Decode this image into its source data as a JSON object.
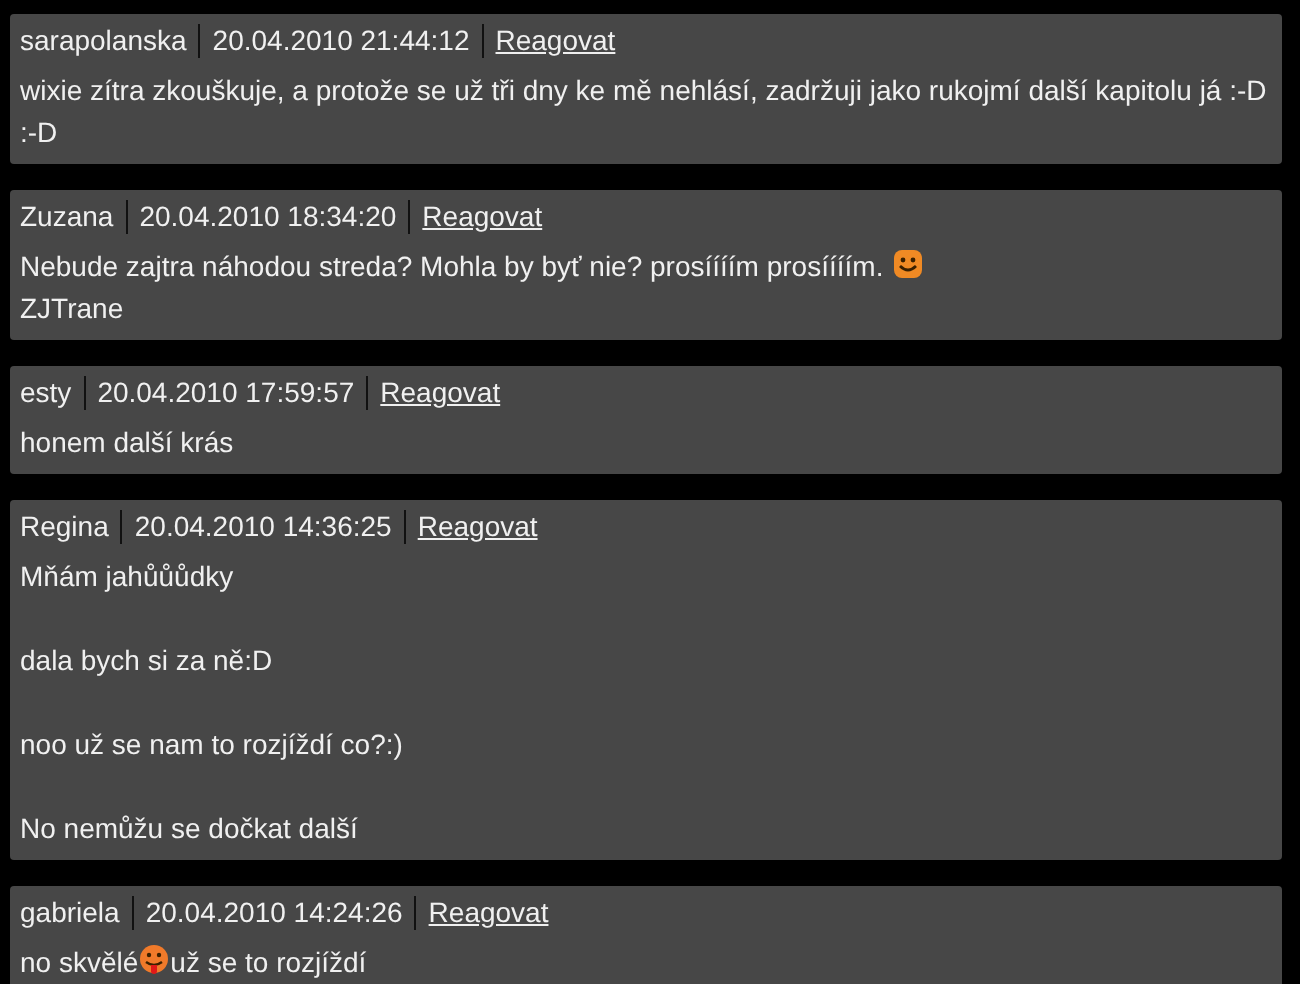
{
  "comments": [
    {
      "author": "sarapolanska",
      "date": "20.04.2010 21:44:12",
      "reply": "Reagovat",
      "paragraphs": [
        {
          "lines": [
            [
              {
                "kind": "text",
                "text": "wixie zítra zkouškuje, a protože se už tři dny ke mě nehlásí, zadržuji jako rukojmí další kapitolu já :-D :-D"
              }
            ]
          ]
        }
      ]
    },
    {
      "author": "Zuzana",
      "date": "20.04.2010 18:34:20",
      "reply": "Reagovat",
      "paragraphs": [
        {
          "lines": [
            [
              {
                "kind": "text",
                "text": "Nebude zajtra náhodou streda? Mohla by byť nie? prosíííím prosíííím."
              },
              {
                "kind": "smile"
              }
            ],
            [
              {
                "kind": "text",
                "text": "ZJTrane"
              }
            ]
          ]
        }
      ]
    },
    {
      "author": "esty",
      "date": "20.04.2010 17:59:57",
      "reply": "Reagovat",
      "paragraphs": [
        {
          "lines": [
            [
              {
                "kind": "text",
                "text": "honem další krás"
              }
            ]
          ]
        }
      ]
    },
    {
      "author": "Regina",
      "date": "20.04.2010 14:36:25",
      "reply": "Reagovat",
      "paragraphs": [
        {
          "lines": [
            [
              {
                "kind": "text",
                "text": "Mňám jahůůůdky"
              }
            ]
          ]
        },
        {
          "lines": [
            [
              {
                "kind": "text",
                "text": "dala bych si za ně:D"
              }
            ]
          ]
        },
        {
          "lines": [
            [
              {
                "kind": "text",
                "text": "noo už se nam to rozjíždí co?:)"
              }
            ]
          ]
        },
        {
          "lines": [
            [
              {
                "kind": "text",
                "text": "No nemůžu se dočkat další"
              }
            ]
          ]
        }
      ]
    },
    {
      "author": "gabriela",
      "date": "20.04.2010 14:24:26",
      "reply": "Reagovat",
      "paragraphs": [
        {
          "lines": [
            [
              {
                "kind": "text",
                "text": "no skvělé"
              },
              {
                "kind": "tongue"
              },
              {
                "kind": "text",
                "text": "už se to rozjíždí"
              }
            ]
          ]
        }
      ]
    }
  ]
}
